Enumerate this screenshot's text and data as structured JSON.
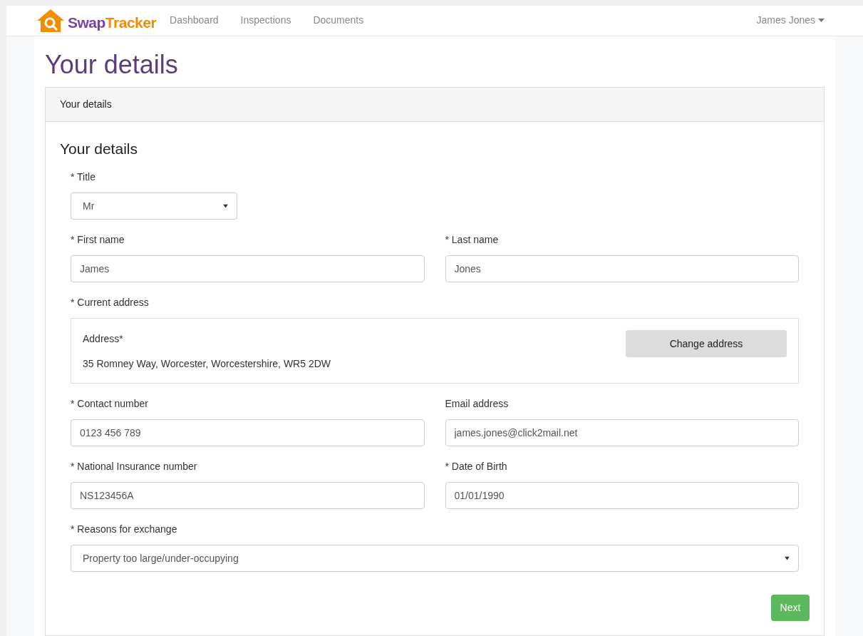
{
  "navbar": {
    "logo": {
      "first": "Swap",
      "second": "Tracker"
    },
    "links": [
      {
        "label": "Dashboard"
      },
      {
        "label": "Inspections"
      },
      {
        "label": "Documents"
      }
    ],
    "user": "James Jones"
  },
  "page_title": "Your details",
  "panel": {
    "header": "Your details",
    "heading": "Your details",
    "rows": [
      {
        "fields": [
          {
            "kind": "short_select",
            "label": "* Title",
            "value": "Mr"
          }
        ]
      },
      {
        "fields": [
          {
            "kind": "text",
            "label": "* First name",
            "value": "James"
          },
          {
            "kind": "text",
            "label": "* Last name",
            "value": "Jones"
          }
        ]
      },
      {
        "fields": [
          {
            "kind": "address",
            "label": "* Current address",
            "caption": "Address*",
            "value": "35 Romney Way, Worcester, Worcestershire, WR5 2DW",
            "button": "Change address"
          }
        ]
      },
      {
        "fields": [
          {
            "kind": "text",
            "label": "* Contact number",
            "value": "0123 456 789"
          },
          {
            "kind": "text",
            "label": "Email address",
            "value": "james.jones@click2mail.net"
          }
        ]
      },
      {
        "fields": [
          {
            "kind": "text",
            "label": "* National Insurance number",
            "value": "NS123456A"
          },
          {
            "kind": "text",
            "label": "* Date of Birth",
            "value": "01/01/1990"
          }
        ]
      },
      {
        "fields": [
          {
            "kind": "select",
            "label": "* Reasons for exchange",
            "value": "Property too large/under-occupying"
          }
        ]
      }
    ],
    "submit": "Next"
  }
}
